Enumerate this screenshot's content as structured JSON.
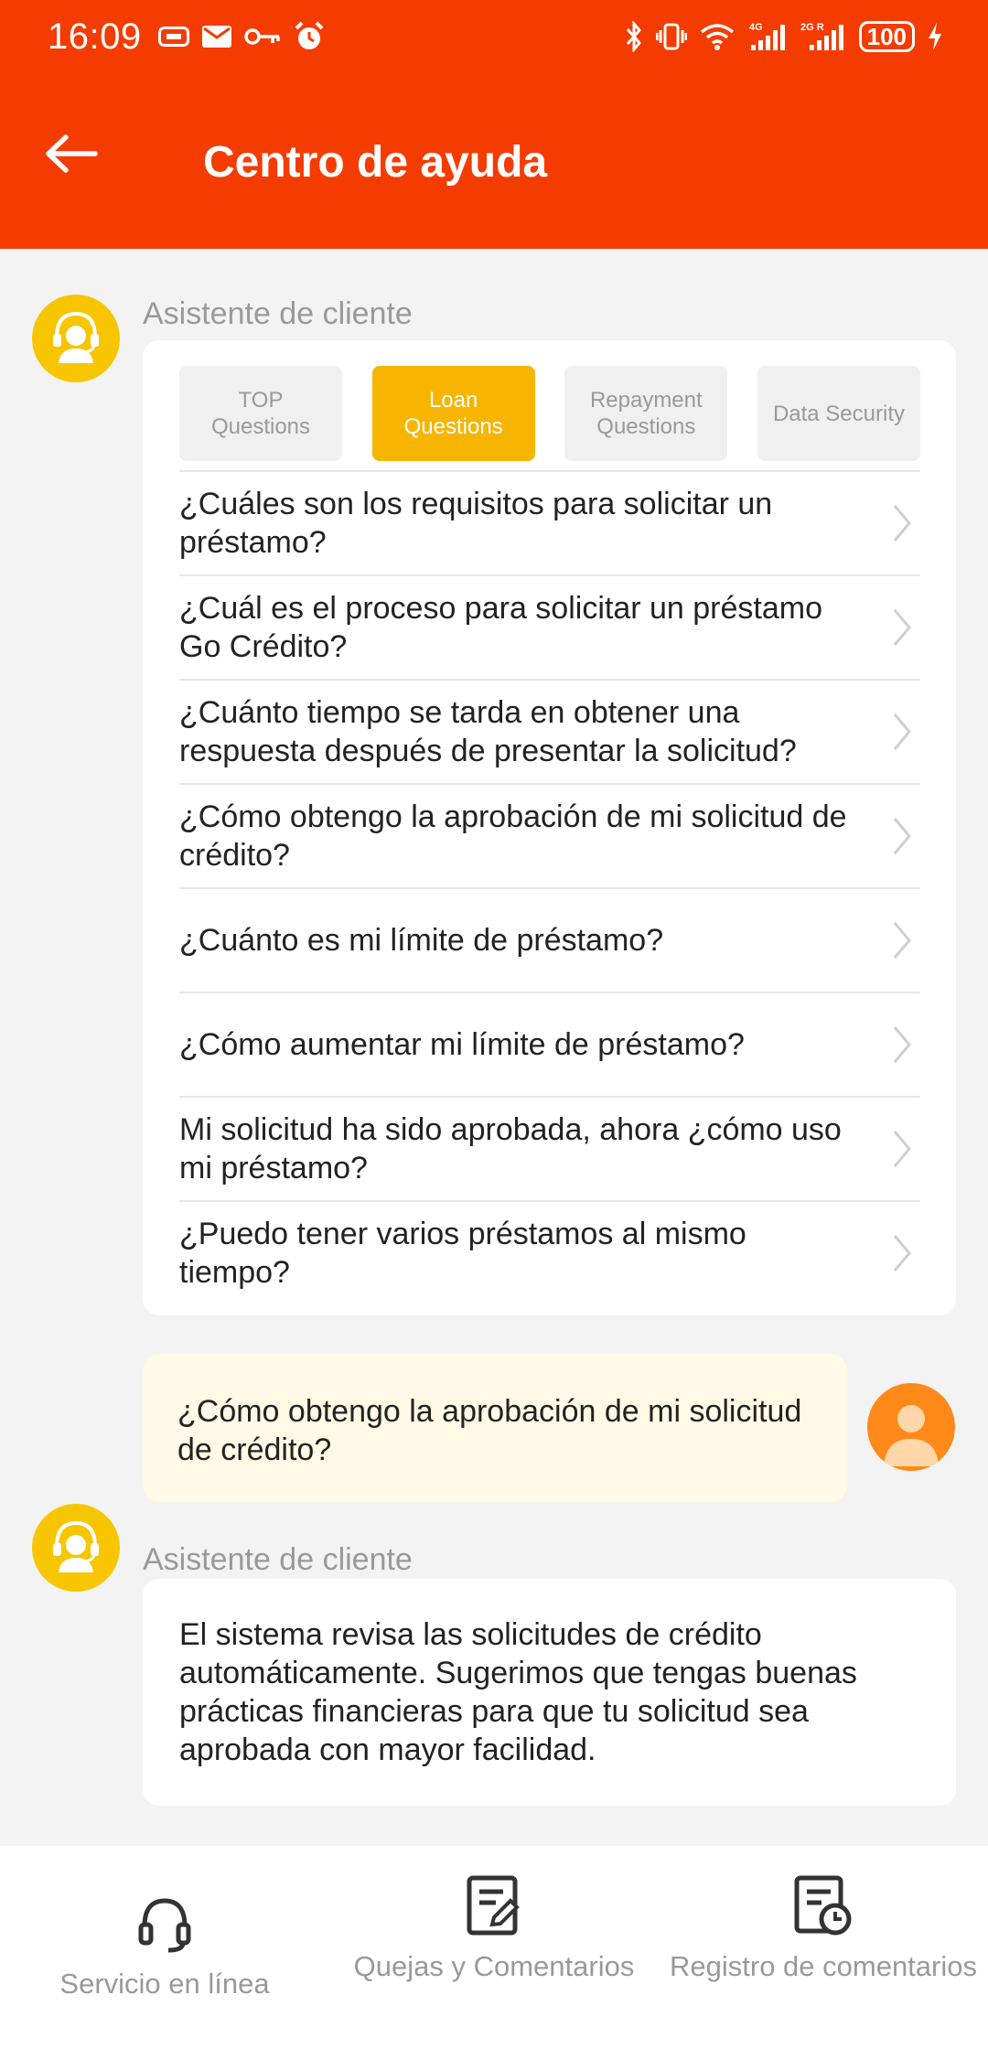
{
  "status_bar": {
    "time": "16:09",
    "network_1": "4G",
    "network_2": "2G R",
    "battery": "100"
  },
  "header": {
    "title": "Centro de ayuda"
  },
  "chat": {
    "assistant_name": "Asistente de cliente",
    "tabs": [
      {
        "label": "TOP Questions",
        "active": false
      },
      {
        "label": "Loan Questions",
        "active": true
      },
      {
        "label": "Repayment Questions",
        "active": false
      },
      {
        "label": "Data Security",
        "active": false
      }
    ],
    "faq": [
      "¿Cuáles son los requisitos para solicitar un préstamo?",
      "¿Cuál es el proceso para solicitar un préstamo Go Crédito?",
      "¿Cuánto tiempo se tarda en obtener una respuesta después de presentar la solicitud?",
      "¿Cómo obtengo la aprobación de mi solicitud de crédito?",
      "¿Cuánto es mi límite de préstamo?",
      "¿Cómo aumentar mi límite de préstamo?",
      "Mi solicitud ha sido aprobada, ahora ¿cómo uso mi préstamo?",
      "¿Puedo tener varios préstamos al mismo tiempo?"
    ],
    "user_message": "¿Cómo obtengo la aprobación de mi solicitud de crédito?",
    "assistant_reply": "El sistema revisa las solicitudes de crédito automáticamente. Sugerimos que tengas buenas prácticas financieras para que tu solicitud sea aprobada con mayor facilidad."
  },
  "bottom_nav": [
    {
      "label": "Servicio en línea",
      "icon": "headset-icon"
    },
    {
      "label": "Quejas y Comentarios",
      "icon": "edit-document-icon"
    },
    {
      "label": "Registro de comentarios",
      "icon": "document-clock-icon"
    }
  ],
  "colors": {
    "brand": "#f53c00",
    "accent": "#f7b500",
    "bot_avatar": "#f7c600",
    "user_avatar": "#ff8a1a",
    "user_bubble": "#fff9e6"
  }
}
